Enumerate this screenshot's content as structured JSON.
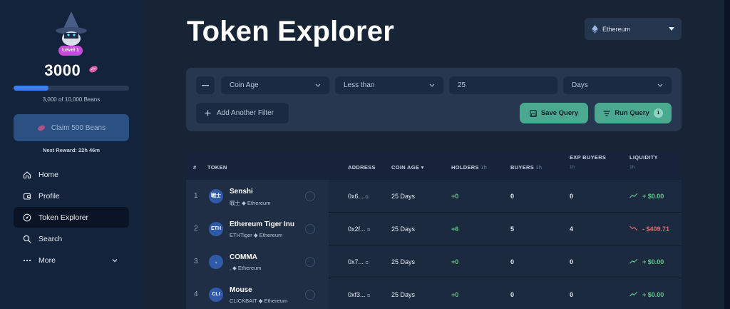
{
  "sidebar": {
    "level": "Level 1",
    "beans": "3000",
    "progress_text": "3,000 of 10,000 Beans",
    "progress_fraction": 0.3,
    "claim_label": "Claim 500 Beans",
    "next_reward": "Next Reward: 22h 46m",
    "nav": [
      {
        "label": "Home",
        "icon": "home-icon"
      },
      {
        "label": "Profile",
        "icon": "wallet-icon"
      },
      {
        "label": "Token Explorer",
        "icon": "compass-icon",
        "active": true
      },
      {
        "label": "Search",
        "icon": "search-icon"
      },
      {
        "label": "More",
        "icon": "more-icon"
      }
    ]
  },
  "header": {
    "title": "Token Explorer",
    "chain": "Ethereum"
  },
  "filters": {
    "field": "Coin Age",
    "operator": "Less than",
    "value": "25",
    "unit": "Days",
    "add_label": "Add Another Filter",
    "save_label": "Save Query",
    "run_label": "Run Query",
    "run_count": "1"
  },
  "table": {
    "headers": {
      "rank": "#",
      "token": "TOKEN",
      "address": "ADDRESS",
      "coin_age": "COIN AGE",
      "holders": "HOLDERS",
      "buyers": "BUYERS",
      "exp_buyers": "EXP BUYERS",
      "liquidity": "LIQUIDITY",
      "timeframe": "1h"
    },
    "rows": [
      {
        "rank": "1",
        "logo": "戦士",
        "name": "Senshi",
        "symbol": "戦士",
        "chain": "Ethereum",
        "address": "0x6...",
        "age": "25 Days",
        "holders": "+0",
        "buyers": "0",
        "exp_buyers": "0",
        "liquidity": "+ $0.00",
        "trend": "up"
      },
      {
        "rank": "2",
        "logo": "ETH",
        "name": "Ethereum Tiger Inu",
        "symbol": "ETHTiger",
        "chain": "Ethereum",
        "address": "0x2f...",
        "age": "25 Days",
        "holders": "+6",
        "buyers": "5",
        "exp_buyers": "4",
        "liquidity": "- $409.71",
        "trend": "down"
      },
      {
        "rank": "3",
        "logo": ",",
        "name": "COMMA",
        "symbol": ",",
        "chain": "Ethereum",
        "address": "0x7...",
        "age": "25 Days",
        "holders": "+0",
        "buyers": "0",
        "exp_buyers": "0",
        "liquidity": "+ $0.00",
        "trend": "up"
      },
      {
        "rank": "4",
        "logo": "CLI",
        "name": "Mouse",
        "symbol": "CLICKBAIT",
        "chain": "Ethereum",
        "address": "0xf3...",
        "age": "25 Days",
        "holders": "+0",
        "buyers": "0",
        "exp_buyers": "0",
        "liquidity": "+ $0.00",
        "trend": "up"
      }
    ]
  },
  "colors": {
    "accent_green": "#4aa98e",
    "positive": "#5fc78a",
    "negative": "#e26b6b",
    "progress_blue": "#3d7ef0",
    "level_pink": "#c74bd8"
  }
}
